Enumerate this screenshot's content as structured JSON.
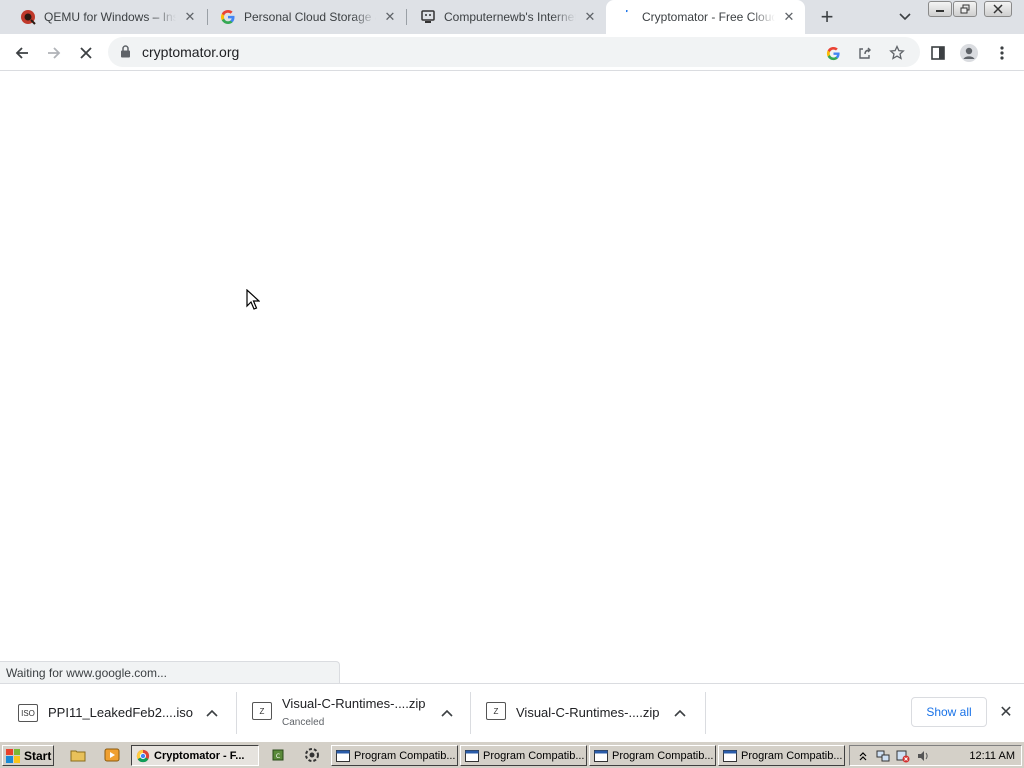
{
  "browser": {
    "tabs": [
      {
        "title": "QEMU for Windows – Ins",
        "icon": "qemu-icon"
      },
      {
        "title": "Personal Cloud Storage &",
        "icon": "google-icon"
      },
      {
        "title": "Computernewb's Internet",
        "icon": "computernewb-icon"
      },
      {
        "title": "Cryptomator - Free Cloud",
        "icon": "loading-spinner-icon",
        "active": true
      }
    ],
    "url": "cryptomator.org",
    "status_text": "Waiting for www.google.com..."
  },
  "downloads": {
    "items": [
      {
        "name": "PPI11_LeakedFeb2....iso",
        "status": "",
        "icon_label": "ISO"
      },
      {
        "name": "Visual-C-Runtimes-....zip",
        "status": "Canceled",
        "icon_label": "Z"
      },
      {
        "name": "Visual-C-Runtimes-....zip",
        "status": "",
        "icon_label": "Z"
      }
    ],
    "show_all": "Show all"
  },
  "taskbar": {
    "start": "Start",
    "tasks": [
      {
        "label": "Cryptomator - F...",
        "active": true
      },
      {
        "label": "Program Compatib..."
      },
      {
        "label": "Program Compatib..."
      },
      {
        "label": "Program Compatib..."
      },
      {
        "label": "Program Compatib..."
      }
    ],
    "clock": "12:11 AM"
  },
  "colors": {
    "accent": "#1a73e8",
    "tabstrip": "#dee1e6",
    "taskbar": "#d4d0c8"
  }
}
